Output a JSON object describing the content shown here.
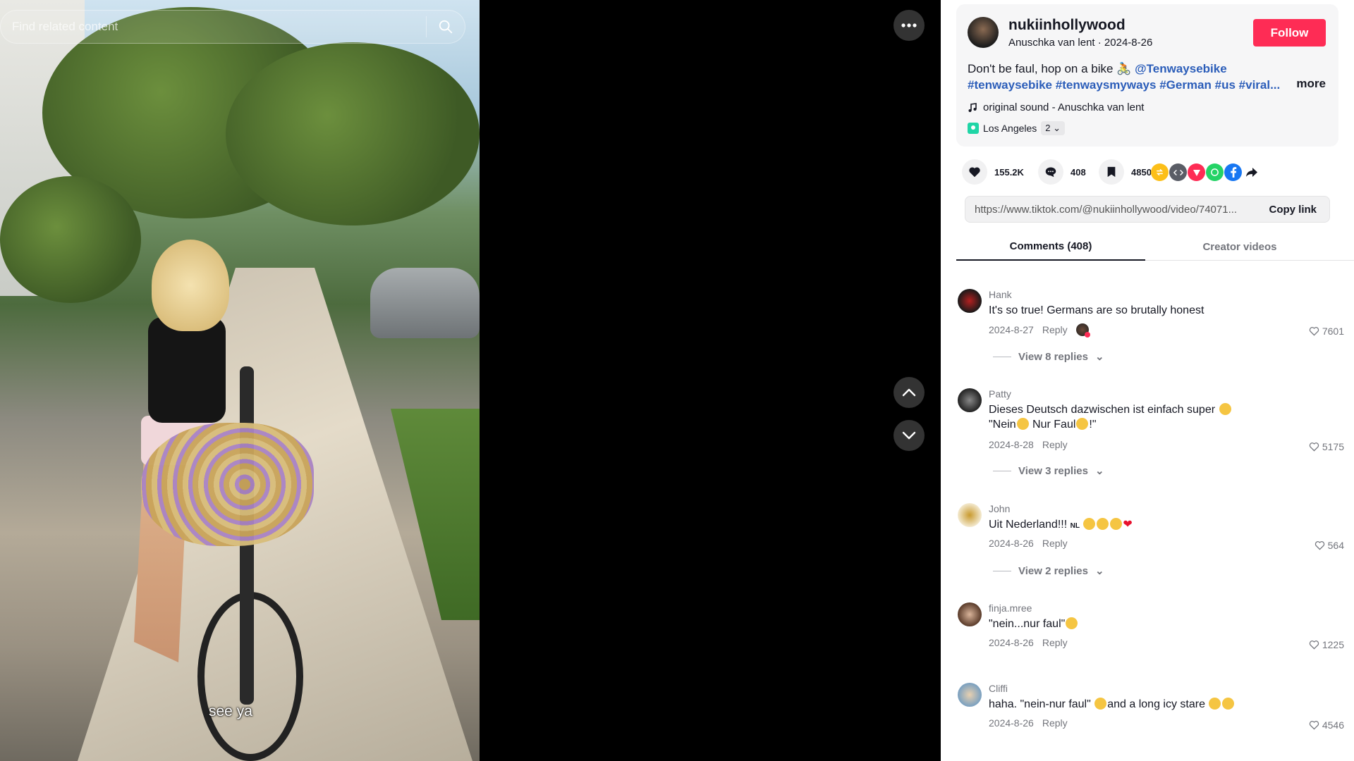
{
  "search": {
    "placeholder": "Find related content"
  },
  "video": {
    "caption": "see ya"
  },
  "post": {
    "author": "nukiinhollywood",
    "display_name": "Anuschka van lent",
    "date": "2024-8-26",
    "follow_label": "Follow",
    "description_text": "Don't be faul, hop on a bike 🚴",
    "mention": "@Tenwaysebike",
    "hashtags": [
      "#tenwaysebike",
      "#tenwaysmyways",
      "#German",
      "#us",
      "#viral..."
    ],
    "more_label": "more",
    "sound": "original sound - Anuschka van lent",
    "location": "Los Angeles",
    "location_count": "2"
  },
  "stats": {
    "likes": "155.2K",
    "comments": "408",
    "saves": "4850"
  },
  "share_icons": [
    "repost-icon",
    "embed-icon",
    "send-icon",
    "whatsapp-icon",
    "facebook-icon",
    "share-arrow-icon"
  ],
  "link": {
    "url": "https://www.tiktok.com/@nukiinhollywood/video/74071...",
    "copy_label": "Copy link"
  },
  "tabs": {
    "comments": "Comments (408)",
    "creator": "Creator videos"
  },
  "comments": [
    {
      "user": "Hank",
      "text": "It's so true! Germans are so brutally honest",
      "date": "2024-8-27",
      "reply": "Reply",
      "likes": "7601",
      "view_replies": "View 8 replies"
    },
    {
      "user": "Patty",
      "text_line1": "Dieses Deutsch dazwischen ist einfach super",
      "text_line2_a": "\"Nein",
      "text_line2_b": " Nur Faul",
      "text_line2_c": "!\"",
      "date": "2024-8-28",
      "reply": "Reply",
      "likes": "5175",
      "view_replies": "View 3 replies"
    },
    {
      "user": "John",
      "text": "Uit Nederland!!!",
      "flag": "NL",
      "date": "2024-8-26",
      "reply": "Reply",
      "likes": "564",
      "view_replies": "View 2 replies"
    },
    {
      "user": "finja.mree",
      "text": "\"nein...nur faul\"",
      "date": "2024-8-26",
      "reply": "Reply",
      "likes": "1225"
    },
    {
      "user": "Cliffi",
      "text_a": "haha. \"nein-nur faul\" ",
      "text_b": "and a long icy stare ",
      "date": "2024-8-26",
      "reply": "Reply",
      "likes": "4546"
    }
  ],
  "colors": {
    "follow": "#fe2c55",
    "link_tag": "#2b5db9",
    "muted": "#73757c"
  }
}
